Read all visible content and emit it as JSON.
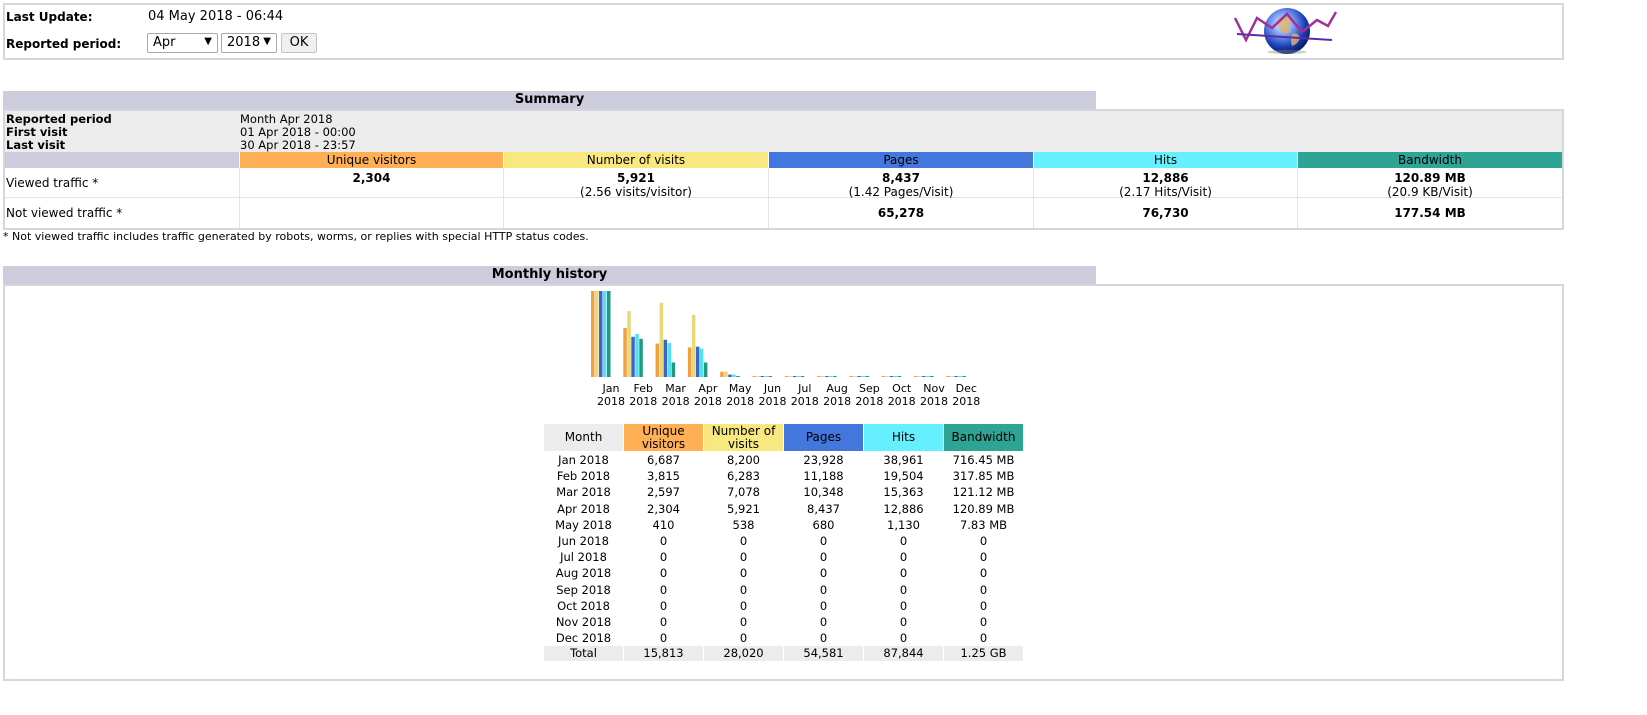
{
  "header": {
    "last_update_label": "Last Update:",
    "last_update_value": "04 May 2018 - 06:44",
    "reported_period_label": "Reported period:",
    "month_select": "Apr",
    "year_select": "2018",
    "ok_button": "OK"
  },
  "summary": {
    "title": "Summary",
    "info": [
      {
        "label": "Reported period",
        "value": "Month Apr 2018"
      },
      {
        "label": "First visit",
        "value": "01 Apr 2018 - 00:00"
      },
      {
        "label": "Last visit",
        "value": "30 Apr 2018 - 23:57"
      }
    ],
    "columns": [
      "Unique visitors",
      "Number of visits",
      "Pages",
      "Hits",
      "Bandwidth"
    ],
    "column_colors": [
      "#ffb055",
      "#f8e880",
      "#4477dd",
      "#66f0ff",
      "#2ea495"
    ],
    "viewed": {
      "label": "Viewed traffic *",
      "unique_visitors": "2,304",
      "visits": "5,921",
      "visits_sub": "(2.56 visits/visitor)",
      "pages": "8,437",
      "pages_sub": "(1.42 Pages/Visit)",
      "hits": "12,886",
      "hits_sub": "(2.17 Hits/Visit)",
      "bandwidth": "120.89 MB",
      "bandwidth_sub": "(20.9 KB/Visit)"
    },
    "not_viewed": {
      "label": "Not viewed traffic *",
      "pages": "65,278",
      "hits": "76,730",
      "bandwidth": "177.54 MB"
    },
    "footnote": "* Not viewed traffic includes traffic generated by robots, worms, or replies with special HTTP status codes."
  },
  "monthly": {
    "title": "Monthly history",
    "table_headers": {
      "month": "Month",
      "unique_visitors": [
        "Unique",
        "visitors"
      ],
      "visits": [
        "Number of",
        "visits"
      ],
      "pages": "Pages",
      "hits": "Hits",
      "bandwidth": "Bandwidth"
    },
    "rows": [
      [
        "Jan 2018",
        "6,687",
        "8,200",
        "23,928",
        "38,961",
        "716.45 MB"
      ],
      [
        "Feb 2018",
        "3,815",
        "6,283",
        "11,188",
        "19,504",
        "317.85 MB"
      ],
      [
        "Mar 2018",
        "2,597",
        "7,078",
        "10,348",
        "15,363",
        "121.12 MB"
      ],
      [
        "Apr 2018",
        "2,304",
        "5,921",
        "8,437",
        "12,886",
        "120.89 MB"
      ],
      [
        "May 2018",
        "410",
        "538",
        "680",
        "1,130",
        "7.83 MB"
      ],
      [
        "Jun 2018",
        "0",
        "0",
        "0",
        "0",
        "0"
      ],
      [
        "Jul 2018",
        "0",
        "0",
        "0",
        "0",
        "0"
      ],
      [
        "Aug 2018",
        "0",
        "0",
        "0",
        "0",
        "0"
      ],
      [
        "Sep 2018",
        "0",
        "0",
        "0",
        "0",
        "0"
      ],
      [
        "Oct 2018",
        "0",
        "0",
        "0",
        "0",
        "0"
      ],
      [
        "Nov 2018",
        "0",
        "0",
        "0",
        "0",
        "0"
      ],
      [
        "Dec 2018",
        "0",
        "0",
        "0",
        "0",
        "0"
      ]
    ],
    "total": [
      "Total",
      "15,813",
      "28,020",
      "54,581",
      "87,844",
      "1.25 GB"
    ]
  },
  "chart_data": {
    "type": "bar",
    "categories": [
      "Jan 2018",
      "Feb 2018",
      "Mar 2018",
      "Apr 2018",
      "May 2018",
      "Jun 2018",
      "Jul 2018",
      "Aug 2018",
      "Sep 2018",
      "Oct 2018",
      "Nov 2018",
      "Dec 2018"
    ],
    "tick_labels_top": [
      "Jan",
      "Feb",
      "Mar",
      "Apr",
      "May",
      "Jun",
      "Jul",
      "Aug",
      "Sep",
      "Oct",
      "Nov",
      "Dec"
    ],
    "tick_labels_bottom": [
      "2018",
      "2018",
      "2018",
      "2018",
      "2018",
      "2018",
      "2018",
      "2018",
      "2018",
      "2018",
      "2018",
      "2018"
    ],
    "series": [
      {
        "name": "Unique visitors",
        "color": "#f0a040",
        "values": [
          6687,
          3815,
          2597,
          2304,
          410,
          0,
          0,
          0,
          0,
          0,
          0,
          0
        ]
      },
      {
        "name": "Number of visits",
        "color": "#e8d878",
        "values": [
          8200,
          6283,
          7078,
          5921,
          538,
          0,
          0,
          0,
          0,
          0,
          0,
          0
        ]
      },
      {
        "name": "Pages",
        "color": "#3a66cc",
        "values": [
          23928,
          11188,
          10348,
          8437,
          680,
          0,
          0,
          0,
          0,
          0,
          0,
          0
        ]
      },
      {
        "name": "Hits",
        "color": "#55e0f0",
        "values": [
          38961,
          19504,
          15363,
          12886,
          1130,
          0,
          0,
          0,
          0,
          0,
          0,
          0
        ]
      },
      {
        "name": "Bandwidth (MB)",
        "color": "#1f9a80",
        "values": [
          716.45,
          317.85,
          121.12,
          120.89,
          7.83,
          0,
          0,
          0,
          0,
          0,
          0,
          0
        ]
      }
    ]
  }
}
